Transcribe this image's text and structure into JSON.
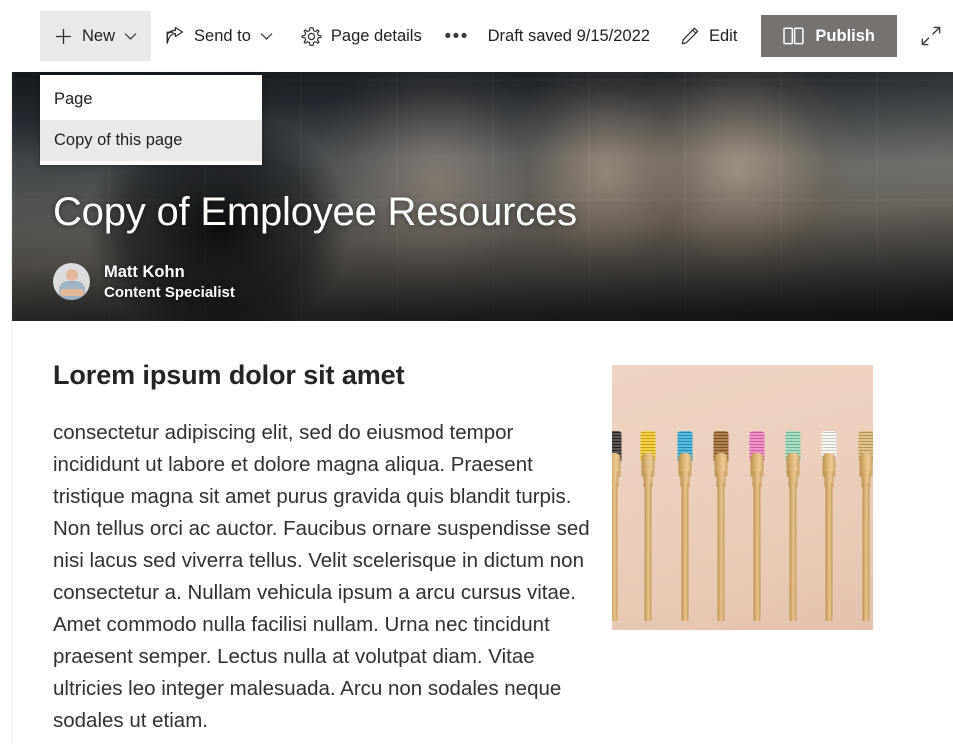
{
  "command_bar": {
    "new_button": {
      "label": "New",
      "icon": "plus-icon",
      "chevron": "⌄"
    },
    "send_to_button": {
      "label": "Send to",
      "icon": "share-icon",
      "chevron": "⌄"
    },
    "page_details_button": {
      "label": "Page details",
      "icon": "gear-icon"
    },
    "more_button": {
      "label": "•••",
      "icon": "ellipsis-icon"
    },
    "draft_status": "Draft saved 9/15/2022",
    "edit_button": {
      "label": "Edit",
      "icon": "pencil-icon"
    },
    "publish_button": {
      "label": "Publish",
      "icon": "page-columns-icon"
    },
    "expand_button": {
      "icon": "expand-diagonal-icon"
    }
  },
  "new_dropdown": {
    "items": [
      {
        "label": "Page",
        "hovered": false
      },
      {
        "label": "Copy of this page",
        "hovered": true
      }
    ]
  },
  "hero": {
    "title": "Copy of Employee Resources",
    "author_name": "Matt Kohn",
    "author_role": "Content Specialist",
    "avatar_alt": "author-avatar",
    "image_alt": "team-hands-together-photo"
  },
  "content": {
    "heading": "Lorem ipsum dolor sit amet",
    "paragraph": "consectetur adipiscing elit, sed do eiusmod tempor incididunt ut labore et dolore magna aliqua. Praesent tristique magna sit amet purus gravida quis blandit turpis. Non tellus orci ac auctor. Faucibus ornare suspendisse sed nisi lacus sed viverra tellus. Velit scelerisque in dictum non consectetur a. Nullam vehicula ipsum a arcu cursus vitae. Amet commodo nulla facilisi nullam. Urna nec tincidunt praesent semper. Lectus nulla at volutpat diam. Vitae ultricies leo integer malesuada. Arcu non sodales neque sodales ut etiam.",
    "image_alt": "bamboo-toothbrushes-photo",
    "image_background_color": "#ecd0bd",
    "brush_bristle_colors": [
      "#2e2a28",
      "#f2c518",
      "#2aa9d6",
      "#9a5f23",
      "#ef74bc",
      "#8fd6b4",
      "#f7f4ee",
      "#d8b169"
    ]
  },
  "colors": {
    "publish_button_bg": "#767270",
    "menu_hover_bg": "#ebe9e7",
    "text_primary": "#201f1e"
  }
}
